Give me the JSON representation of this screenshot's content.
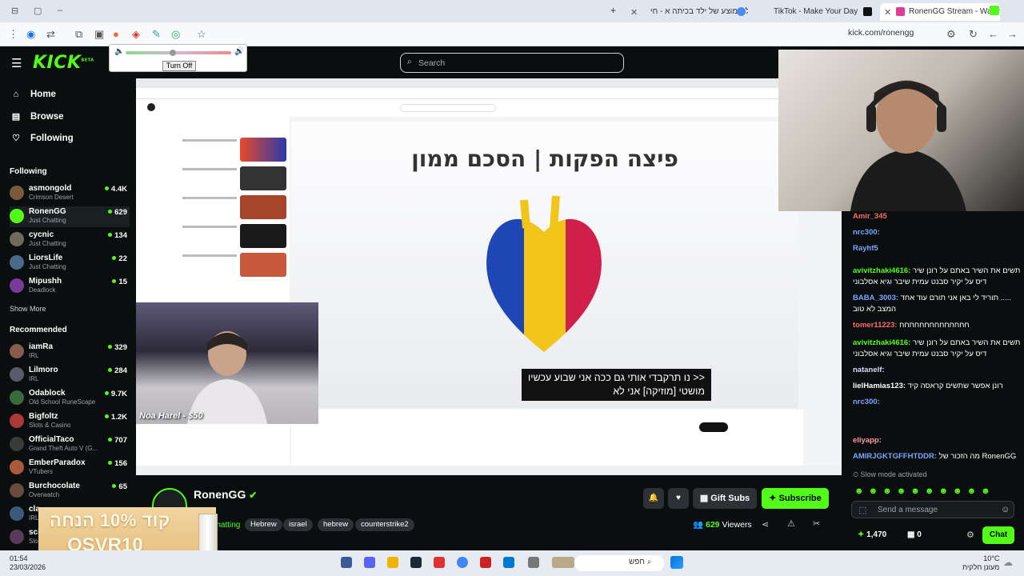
{
  "browser": {
    "tabs": [
      {
        "label": "גיל ממוצע של ילד בכיתה א - חי"
      },
      {
        "label": "TikTok - Make Your Day"
      },
      {
        "label": "RonenGG Stream - Watch L"
      }
    ],
    "url": "kick.com/ronengg"
  },
  "volume_popup": {
    "turn_off_label": "Turn Off",
    "level": 0.45
  },
  "header": {
    "logo": "KICK",
    "logo_badge": "BETA",
    "search_placeholder": "Search"
  },
  "sidebar": {
    "nav": [
      {
        "label": "Home",
        "icon": "home-icon"
      },
      {
        "label": "Browse",
        "icon": "browse-icon"
      },
      {
        "label": "Following",
        "icon": "heart-icon"
      }
    ],
    "following_title": "Following",
    "following": [
      {
        "name": "asmongold",
        "category": "Crimson Desert",
        "viewers": "4.4K",
        "color": "#7a5a3a"
      },
      {
        "name": "RonenGG",
        "category": "Just Chatting",
        "viewers": "629",
        "color": "#53fc18"
      },
      {
        "name": "cycnic",
        "category": "Just Chatting",
        "viewers": "134",
        "color": "#6f6a5a"
      },
      {
        "name": "LiorsLife",
        "category": "Just Chatting",
        "viewers": "22",
        "color": "#4a6a8a"
      },
      {
        "name": "Mipushh",
        "category": "Deadlock",
        "viewers": "15",
        "color": "#7a3a9a"
      }
    ],
    "show_more": "Show More",
    "recommended_title": "Recommended",
    "recommended": [
      {
        "name": "iamRa",
        "category": "IRL",
        "viewers": "329",
        "color": "#8a5a4a"
      },
      {
        "name": "Lilmoro",
        "category": "IRL",
        "viewers": "284",
        "color": "#5a5a6a"
      },
      {
        "name": "Odablock",
        "category": "Old School RuneScape",
        "viewers": "9.7K",
        "color": "#3a6a3a"
      },
      {
        "name": "Bigfoltz",
        "category": "Slots & Casino",
        "viewers": "1.2K",
        "color": "#aa3a3a"
      },
      {
        "name": "OfficialTaco",
        "category": "Grand Theft Auto V (G...",
        "viewers": "707",
        "color": "#3a3a3a"
      },
      {
        "name": "EmberParadox",
        "category": "VTubers",
        "viewers": "156",
        "color": "#aa5a3a"
      },
      {
        "name": "Burchocolate",
        "category": "Overwatch",
        "viewers": "65",
        "color": "#6a4a3a"
      },
      {
        "name": "cla",
        "category": "IRL",
        "viewers": "",
        "color": "#3a5a7a"
      },
      {
        "name": "sci",
        "category": "Slo",
        "viewers": "",
        "color": "#5a3a5a"
      }
    ]
  },
  "stream": {
    "player_title": "פיצה הפקות | הסכם ממון",
    "subtitle_line1": "<< נו תרקבדי אותי גם ככה אני שבוע עכשיו",
    "subtitle_line2": "מושטי [מוזיקה] אני לא",
    "cam_overlay_name": "Noa Harel - $50"
  },
  "chat": {
    "messages": [
      {
        "user": "Amir_345",
        "text": "",
        "color": "#ff6b6b"
      },
      {
        "user": "nrc300:",
        "text": "",
        "color": "#7aa6ff"
      },
      {
        "user": "Rayhf5",
        "text": "",
        "color": "#7aa6ff"
      },
      {
        "user": "avivitzhaki4616:",
        "text": "תשים את השיר באתם על רונן שיר",
        "color": "#53fc18"
      },
      {
        "user": "",
        "text": "דיס על יקיר סבנט עמית שיבר וגיא אסלבוני",
        "color": "#fff"
      },
      {
        "user": "BABA_3003:",
        "text": "תוריד לי באן אני תורם עוד אחד .....",
        "color": "#7aa6ff"
      },
      {
        "user": "",
        "text": "המצב לא טוב",
        "color": "#fff"
      },
      {
        "user": "tomer11223:",
        "text": "חחחחחחחחחחחחחח",
        "color": "#ff6b6b"
      },
      {
        "user": "avivitzhaki4616:",
        "text": "תשים את השיר באתם על רונן שיר",
        "color": "#53fc18"
      },
      {
        "user": "",
        "text": "דיס על יקיר סבנט עמית שיבר וגיא אסלבוני",
        "color": "#fff"
      },
      {
        "user": "natanelf:",
        "text": "",
        "color": "#d8d8ff"
      },
      {
        "user": "lielHamias123:",
        "text": "רונן אפשר שתשים קראסה קיד",
        "color": "#fff"
      },
      {
        "user": "nrc300:",
        "text": "",
        "color": "#7aa6ff"
      },
      {
        "user": "eliyapp:",
        "text": "",
        "color": "#ff9b9b"
      },
      {
        "user": "AMIRJGKTGFFHTDDR:",
        "text": "מה הזכור של RonenGG",
        "color": "#7aa6ff"
      }
    ],
    "slow_mode": "Slow mode activated",
    "input_placeholder": "Send a message",
    "points": "1,470",
    "points2": "0",
    "chat_button": "Chat"
  },
  "channel": {
    "name": "RonenGG",
    "category": "Just Chatting",
    "tags": [
      "Hebrew",
      "israel",
      "hebrew",
      "counterstrike2"
    ],
    "viewers": "629",
    "viewers_label": "Viewers",
    "gift_label": "Gift Subs",
    "subscribe_label": "Subscribe"
  },
  "ad": {
    "line1": "קוד 10% הנחה",
    "line2": "OSVR10"
  },
  "taskbar": {
    "time": "01:54",
    "date": "23/03/2026",
    "search_label": "חפש",
    "temp": "10°C",
    "weather": "מעונן חלקית"
  },
  "colors": {
    "accent": "#53fc18",
    "bg": "#0b0e0f"
  }
}
